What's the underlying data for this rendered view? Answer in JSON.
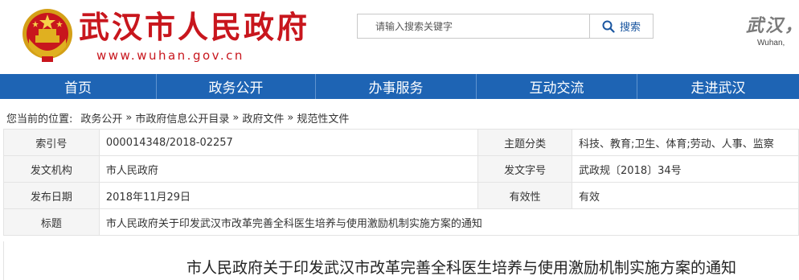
{
  "header": {
    "title": "武汉市人民政府",
    "url": "www.wuhan.gov.cn",
    "corner_cn": "武汉，",
    "corner_en": "Wuhan,"
  },
  "search": {
    "placeholder": "请输入搜索关键字",
    "button_label": "搜索"
  },
  "nav": {
    "items": [
      {
        "label": "首页"
      },
      {
        "label": "政务公开"
      },
      {
        "label": "办事服务"
      },
      {
        "label": "互动交流"
      },
      {
        "label": "走进武汉"
      }
    ]
  },
  "breadcrumb": {
    "prefix": "您当前的位置:",
    "items": [
      "政务公开",
      "市政府信息公开目录",
      "政府文件",
      "规范性文件"
    ],
    "separator": "»"
  },
  "meta": {
    "index_label": "索引号",
    "index_value": "000014348/2018-02257",
    "topic_label": "主题分类",
    "topic_value": "科技、教育;卫生、体育;劳动、人事、监察",
    "issuer_label": "发文机构",
    "issuer_value": "市人民政府",
    "docno_label": "发文字号",
    "docno_value": "武政规〔2018〕34号",
    "date_label": "发布日期",
    "date_value": "2018年11月29日",
    "validity_label": "有效性",
    "validity_value": "有效",
    "title_label": "标题",
    "title_value": "市人民政府关于印发武汉市改革完善全科医生培养与使用激励机制实施方案的通知"
  },
  "article": {
    "title": "市人民政府关于印发武汉市改革完善全科医生培养与使用激励机制实施方案的通知"
  },
  "colors": {
    "brand_red": "#c8161d",
    "nav_blue": "#1e64b4",
    "label_bg": "#f5f5f5"
  },
  "icons": {
    "emblem": "national-emblem-icon",
    "search": "magnifier-icon"
  }
}
